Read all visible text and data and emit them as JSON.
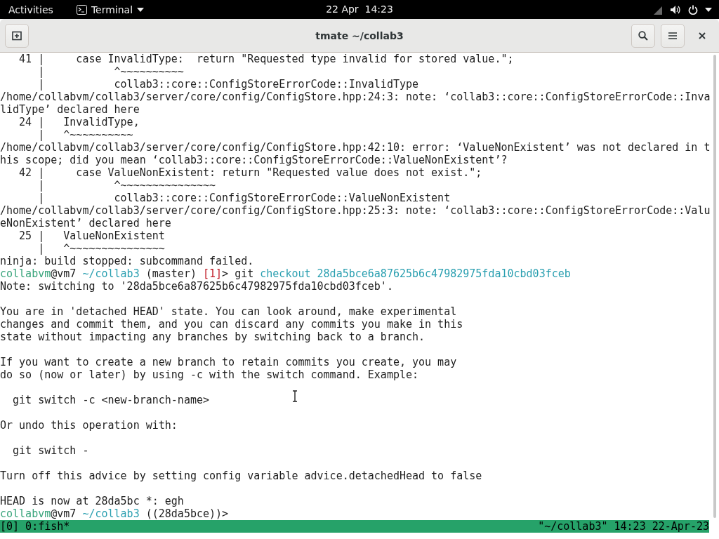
{
  "top_bar": {
    "activities": "Activities",
    "app_menu": "Terminal",
    "clock": "22 Apr  14:23"
  },
  "window": {
    "title": "tmate ~/collab3"
  },
  "terminal": {
    "paragraphs": [
      [
        [
          {
            "kind": "text",
            "text": "   41 |     case InvalidType:  return \"Requested type invalid for stored value.\";"
          }
        ],
        [
          {
            "kind": "text",
            "text": "      |           ^~~~~~~~~~~"
          }
        ],
        [
          {
            "kind": "text",
            "text": "      |           collab3::core::ConfigStoreErrorCode::InvalidType"
          }
        ],
        [
          {
            "kind": "text",
            "text": "/home/collabvm/collab3/server/core/config/ConfigStore.hpp:24:3: note: ‘collab3::core::ConfigStoreErrorCode::Inva"
          }
        ],
        [
          {
            "kind": "text",
            "text": "lidType’ declared here"
          }
        ],
        [
          {
            "kind": "text",
            "text": "   24 |   InvalidType,"
          }
        ],
        [
          {
            "kind": "text",
            "text": "      |   ^~~~~~~~~~~"
          }
        ],
        [
          {
            "kind": "text",
            "text": "/home/collabvm/collab3/server/core/config/ConfigStore.hpp:42:10: error: ‘ValueNonExistent’ was not declared in t"
          }
        ],
        [
          {
            "kind": "text",
            "text": "his scope; did you mean ‘collab3::core::ConfigStoreErrorCode::ValueNonExistent’?"
          }
        ],
        [
          {
            "kind": "text",
            "text": "   42 |     case ValueNonExistent: return \"Requested value does not exist.\";"
          }
        ],
        [
          {
            "kind": "text",
            "text": "      |           ^~~~~~~~~~~~~~~~"
          }
        ],
        [
          {
            "kind": "text",
            "text": "      |           collab3::core::ConfigStoreErrorCode::ValueNonExistent"
          }
        ],
        [
          {
            "kind": "text",
            "text": "/home/collabvm/collab3/server/core/config/ConfigStore.hpp:25:3: note: ‘collab3::core::ConfigStoreErrorCode::Valu"
          }
        ],
        [
          {
            "kind": "text",
            "text": "eNonExistent’ declared here"
          }
        ],
        [
          {
            "kind": "text",
            "text": "   25 |   ValueNonExistent"
          }
        ],
        [
          {
            "kind": "text",
            "text": "      |   ^~~~~~~~~~~~~~~~"
          }
        ],
        [
          {
            "kind": "text",
            "text": "ninja: build stopped: subcommand failed."
          }
        ],
        [
          {
            "kind": "user",
            "text": "collabvm"
          },
          {
            "kind": "text",
            "text": "@vm7 "
          },
          {
            "kind": "path",
            "text": "~/collab3"
          },
          {
            "kind": "text",
            "text": " (master) "
          },
          {
            "kind": "status",
            "text": "[1]"
          },
          {
            "kind": "text",
            "text": "> git "
          },
          {
            "kind": "argument",
            "text": "checkout 28da5bce6a87625b6c47982975fda10cbd03fceb"
          }
        ],
        [
          {
            "kind": "text",
            "text": "Note: switching to '28da5bce6a87625b6c47982975fda10cbd03fceb'."
          }
        ]
      ],
      [
        [
          {
            "kind": "text",
            "text": "You are in 'detached HEAD' state. You can look around, make experimental"
          }
        ],
        [
          {
            "kind": "text",
            "text": "changes and commit them, and you can discard any commits you make in this"
          }
        ],
        [
          {
            "kind": "text",
            "text": "state without impacting any branches by switching back to a branch."
          }
        ]
      ],
      [
        [
          {
            "kind": "text",
            "text": "If you want to create a new branch to retain commits you create, you may"
          }
        ],
        [
          {
            "kind": "text",
            "text": "do so (now or later) by using -c with the switch command. Example:"
          }
        ]
      ],
      [
        [
          {
            "kind": "text",
            "text": "  git switch -c <new-branch-name>"
          }
        ]
      ],
      [
        [
          {
            "kind": "text",
            "text": "Or undo this operation with:"
          }
        ]
      ],
      [
        [
          {
            "kind": "text",
            "text": "  git switch -"
          }
        ]
      ],
      [
        [
          {
            "kind": "text",
            "text": "Turn off this advice by setting config variable advice.detachedHead to false"
          }
        ]
      ],
      [
        [
          {
            "kind": "text",
            "text": "HEAD is now at 28da5bc *: egh"
          }
        ],
        [
          {
            "kind": "user",
            "text": "collabvm"
          },
          {
            "kind": "text",
            "text": "@vm7 "
          },
          {
            "kind": "path",
            "text": "~/collab3"
          },
          {
            "kind": "text",
            "text": " ((28da5bce))>"
          }
        ]
      ]
    ]
  },
  "status_bar": {
    "left": "[0] 0:fish*",
    "right": "\"~/collab3\" 14:23 22-Apr-23"
  }
}
